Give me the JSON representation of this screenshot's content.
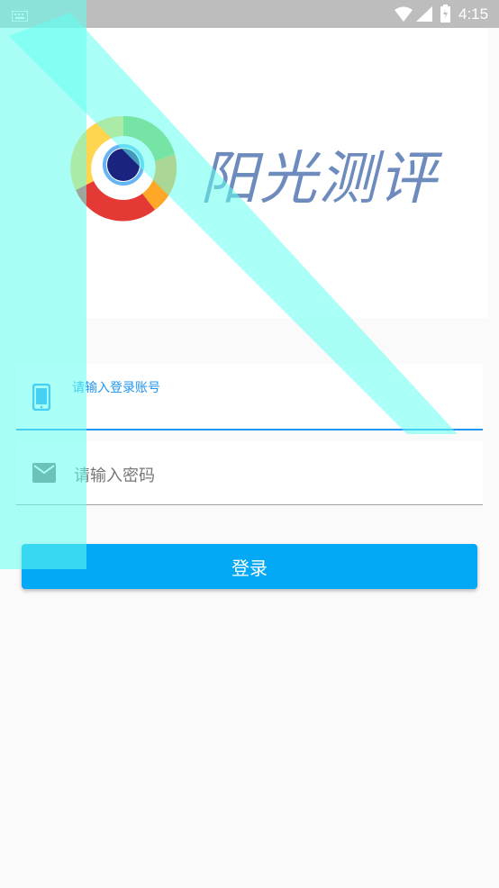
{
  "status_bar": {
    "time": "4:15",
    "icons": [
      "keyboard-icon",
      "wifi-icon",
      "signal-icon",
      "battery-charging-icon"
    ]
  },
  "logo": {
    "text": "阳光测评",
    "icon": "sun-swirl-logo-icon"
  },
  "form": {
    "account": {
      "floating_label": "请输入登录账号",
      "value": "",
      "icon": "phone-icon"
    },
    "password": {
      "placeholder": "请输入密码",
      "value": "",
      "icon": "mail-icon"
    },
    "login_label": "登录"
  },
  "colors": {
    "accent": "#2196f3",
    "button": "#03a9f4",
    "overlay": "#64fff0",
    "logo_text": "#6e8bbd"
  }
}
